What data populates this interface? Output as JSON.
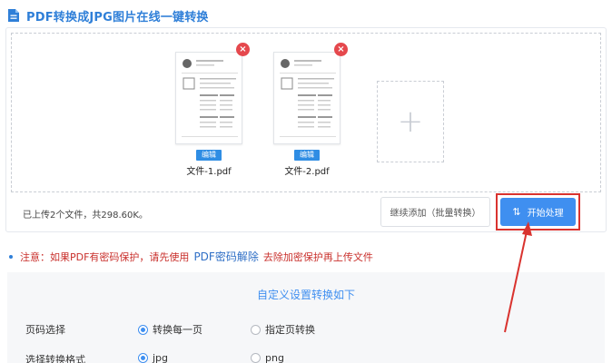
{
  "header": {
    "title": "PDF转换成JPG图片在线一键转换",
    "icon": "document-icon"
  },
  "files": [
    {
      "name": "文件-1.pdf",
      "edit_label": "编辑",
      "delete_label": "×"
    },
    {
      "name": "文件-2.pdf",
      "edit_label": "编辑",
      "delete_label": "×"
    }
  ],
  "add_box": {
    "label": "+"
  },
  "upload_info": "已上传2个文件，共298.60K。",
  "buttons": {
    "continue_label": "继续添加（批量转换）",
    "start_label": "开始处理",
    "start_icon": "⇅"
  },
  "notice": {
    "prefix": "注意：如果PDF有密码保护，请先使用",
    "link": "PDF密码解除",
    "suffix": "去除加密保护再上传文件"
  },
  "settings": {
    "title": "自定义设置转换如下",
    "page_select": {
      "label": "页码选择",
      "options": [
        "转换每一页",
        "指定页转换"
      ],
      "selected": 0
    },
    "format": {
      "label": "选择转换格式",
      "options": [
        "jpg",
        "png"
      ],
      "selected": 0
    }
  },
  "colors": {
    "accent": "#3f8ff0",
    "danger": "#e5484d",
    "highlight": "#d9332f"
  }
}
